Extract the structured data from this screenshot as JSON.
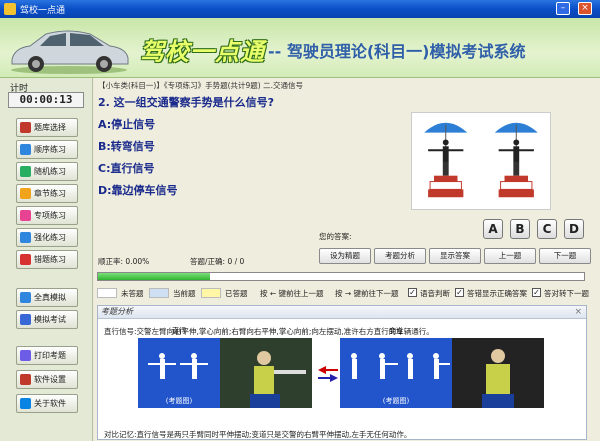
{
  "window": {
    "title": "驾校一点通"
  },
  "banner": {
    "brand": "驾校一点通",
    "subtitle": "-- 驾驶员理论(科目一)模拟考试系统"
  },
  "timer": {
    "label": "计时",
    "value": "00:00:13"
  },
  "sidebar": {
    "items": [
      {
        "label": "题库选择",
        "color": "#c0392b"
      },
      {
        "label": "顺序练习",
        "color": "#2e86de"
      },
      {
        "label": "随机练习",
        "color": "#27ae60"
      },
      {
        "label": "章节练习",
        "color": "#f1a31c"
      },
      {
        "label": "专项练习",
        "color": "#e84393"
      },
      {
        "label": "强化练习",
        "color": "#2e86de"
      },
      {
        "label": "错题练习",
        "color": "#d63031"
      },
      {
        "label": "全真模拟",
        "color": "#2e86de"
      },
      {
        "label": "模拟考试",
        "color": "#3867d6"
      },
      {
        "label": "打印考题",
        "color": "#6c5ce7"
      },
      {
        "label": "软件设置",
        "color": "#c0392b"
      },
      {
        "label": "关于软件",
        "color": "#0984e3"
      }
    ]
  },
  "question": {
    "breadcrumb": "【小车类(科目一)】《专项练习》手势题(共计9题) 二.交通信号",
    "text": "2. 这一组交通警察手势是什么信号?",
    "options": [
      "A:停止信号",
      "B:转弯信号",
      "C:直行信号",
      "D:靠边停车信号"
    ]
  },
  "answer": {
    "label": "您的答案:",
    "buttons": [
      "A",
      "B",
      "C",
      "D"
    ]
  },
  "stats": {
    "rate": "顺正率: 0.00%",
    "count": "答题/正确: 0 / 0"
  },
  "actions": [
    "设为精题",
    "考题分析",
    "显示答案",
    "上一题",
    "下一题"
  ],
  "progress": {
    "fraction": 0.23
  },
  "legend": {
    "unanswered": "未答题",
    "current": "当前题",
    "answered": "已答题",
    "prev_hint": "按 ← 键前往上一题",
    "next_hint": "按 → 键前往下一题",
    "opt_voice": "语音判断",
    "opt_show_correct": "答错显示正确答案",
    "opt_auto_next": "答对转下一题",
    "colors": {
      "unanswered": "#ffffff",
      "current": "#cfe0f5",
      "answered": "#fff7a6"
    }
  },
  "analysis": {
    "title": "考题分析",
    "text": "直行信号:交警左臂向右平伸,掌心向前;右臂向右平伸,掌心向前;向左摆动,准许右方直行的车辆通行。",
    "left_label": "直行",
    "right_label": "变道",
    "figure_label": "(考题图)",
    "memo": "对比记忆:直行信号是两只手臂同时平伸摆动;变道只是交警的右臂平伸摆动,左手无任何动作。"
  }
}
